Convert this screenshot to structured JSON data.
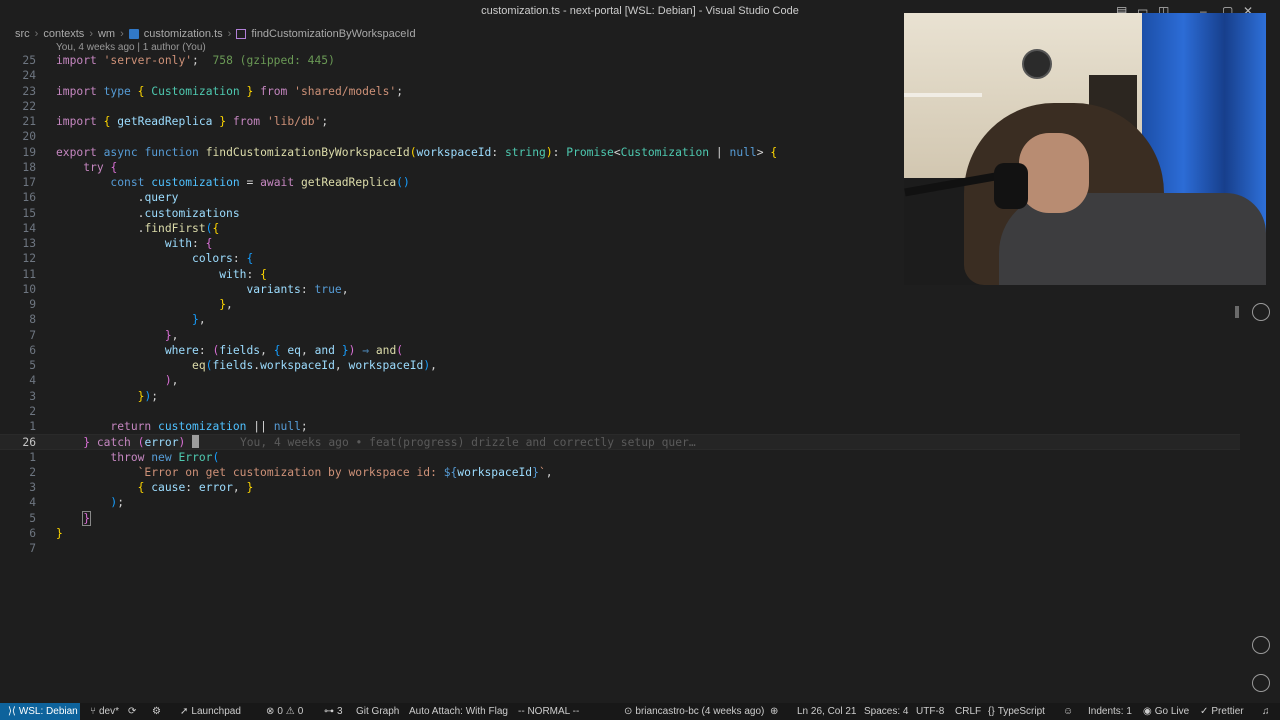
{
  "window": {
    "title": "customization.ts - next-portal [WSL: Debian] - Visual Studio Code"
  },
  "breadcrumb": {
    "parts": [
      "src",
      "contexts",
      "wm",
      "customization.ts",
      "findCustomizationByWorkspaceId"
    ]
  },
  "codelens": "You, 4 weeks ago | 1 author (You)",
  "editor": {
    "line_numbers": [
      "25",
      "24",
      "23",
      "22",
      "21",
      "20",
      "19",
      "18",
      "17",
      "16",
      "15",
      "14",
      "13",
      "12",
      "11",
      "10",
      "9",
      "8",
      "7",
      "6",
      "5",
      "4",
      "3",
      "2",
      "1",
      "26",
      "1",
      "2",
      "3",
      "4",
      "5",
      "6",
      "7"
    ],
    "import_cost": "758 (gzipped: 445)",
    "blame": "You, 4 weeks ago • feat(progress) drizzle and correctly setup quer…"
  },
  "statusbar": {
    "remote": "WSL: Debian",
    "branch": "dev*",
    "launchpad": "Launchpad",
    "errors": "0",
    "warnings": "0",
    "ports": "3",
    "git_graph": "Git Graph",
    "auto_attach": "Auto Attach: With Flag",
    "vim_mode": "-- NORMAL --",
    "blame_author": "briancastro-bc (4 weeks ago)",
    "cursor_pos": "Ln 26, Col 21",
    "spaces": "Spaces: 4",
    "encoding": "UTF-8",
    "eol": "CRLF",
    "language": "TypeScript",
    "indents": "Indents: 1",
    "go_live": "Go Live",
    "prettier": "Prettier"
  },
  "icons": {
    "remote": "remote-icon",
    "branch": "source-control-icon",
    "sync": "sync-icon",
    "launchpad": "rocket-icon",
    "errors": "error-icon",
    "warnings": "warning-icon",
    "ports": "ports-icon",
    "git_graph": "git-graph-icon",
    "blame": "git-commit-icon",
    "zoom": "zoom-icon",
    "copilot": "copilot-icon",
    "go_live": "broadcast-icon",
    "prettier": "check-all-icon",
    "bell": "bell-icon"
  },
  "colors": {
    "keyword": "#569cd6",
    "control": "#c586c0",
    "string": "#ce9178",
    "function": "#dcdcaa",
    "type": "#4ec9b0",
    "variable": "#9cdcfe",
    "remote_bg": "#0e639c"
  }
}
